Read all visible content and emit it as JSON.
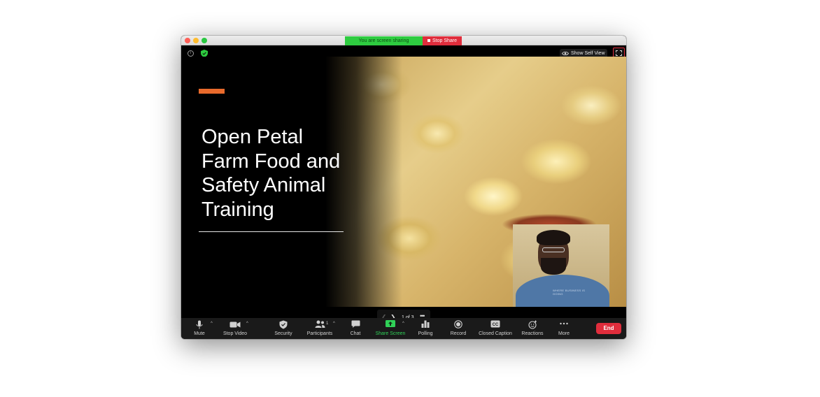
{
  "sharing": {
    "banner": "You are screen sharing",
    "stop_share": "Stop Share"
  },
  "stage": {
    "show_self_view": "Show Self View"
  },
  "slide": {
    "title": "Open Petal\nFarm Food and\nSafety Animal\nTraining",
    "counter": "1 of 3",
    "shirt_text": "WHERE BUSINESS IS GOING"
  },
  "toolbar": {
    "mute": "Mute",
    "stop_video": "Stop Video",
    "security": "Security",
    "participants": "Participants",
    "participants_count": "1",
    "chat": "Chat",
    "share_screen": "Share Screen",
    "polling": "Polling",
    "record": "Record",
    "closed_caption": "Closed Caption",
    "reactions": "Reactions",
    "more": "More",
    "end": "End"
  },
  "icons": {
    "info": "info-icon",
    "shield": "shield-check-icon",
    "eye": "eye-icon",
    "fullscreen": "fullscreen-icon",
    "mic": "microphone-icon",
    "video": "video-camera-icon",
    "participants": "people-icon",
    "chat": "chat-bubble-icon",
    "share": "share-arrow-icon",
    "polling": "bar-chart-icon",
    "record": "record-dot-icon",
    "cc": "cc-icon",
    "reactions": "smiley-plus-icon",
    "more": "ellipsis-icon"
  },
  "colors": {
    "share_green": "#2ecc40",
    "stop_red": "#e02d3c",
    "accent_orange": "#e86a2c",
    "toolbar_bg": "#1a1a1a"
  }
}
